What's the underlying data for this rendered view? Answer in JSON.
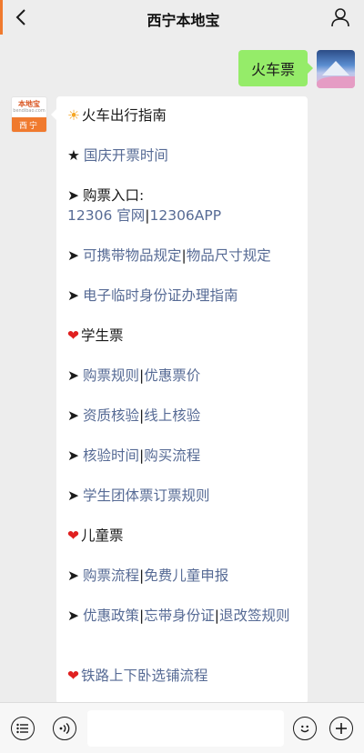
{
  "header": {
    "title": "西宁本地宝",
    "back_icon": "chevron-left-icon",
    "user_icon": "person-icon",
    "accent_color": "#f07a2e"
  },
  "sent_message": {
    "text": "火车票",
    "bubble_color": "#95ec69"
  },
  "bot": {
    "avatar_logo_text": "本地宝",
    "avatar_logo_sub": "bendibao.com",
    "avatar_city": "西宁"
  },
  "message": {
    "link_color": "#576b95",
    "title": "火车出行指南",
    "guoqing": "国庆开票时间",
    "entry_label": "购票入口:",
    "entry_links": [
      "12306 官网",
      "12306APP"
    ],
    "carry_links": [
      "可携带物品规定",
      "物品尺寸规定"
    ],
    "id_guide": "电子临时身份证办理指南",
    "student_heading": "学生票",
    "student_rows": [
      [
        "购票规则",
        "优惠票价"
      ],
      [
        "资质核验",
        "线上核验"
      ],
      [
        "核验时间",
        "购买流程"
      ],
      [
        "学生团体票订票规则"
      ]
    ],
    "child_heading": "儿童票",
    "child_rows": [
      [
        "购票流程",
        "免费儿童申报"
      ],
      [
        "优惠政策",
        "忘带身份证",
        "退改签规则"
      ]
    ],
    "sleeper_heading": "铁路上下卧选铺流程"
  },
  "toolbar": {
    "menu_icon": "menu-list-icon",
    "voice_icon": "voice-icon",
    "emoji_icon": "smiley-icon",
    "plus_icon": "plus-icon",
    "input_value": ""
  }
}
